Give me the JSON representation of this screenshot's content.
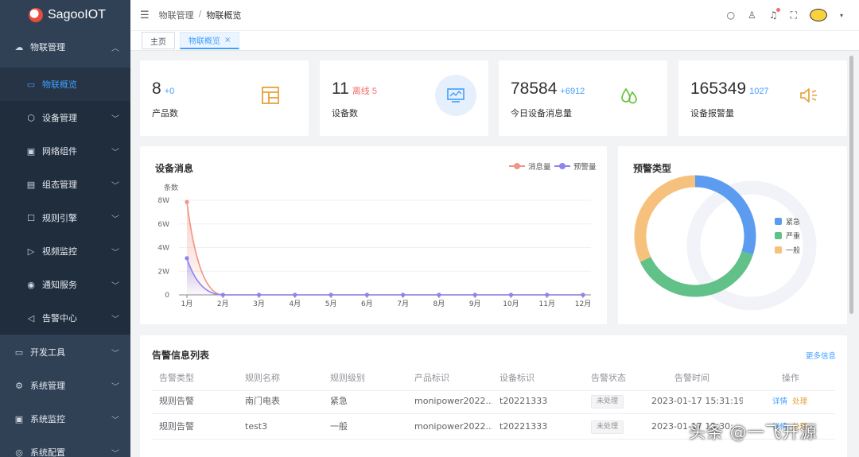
{
  "app": {
    "name": "SagooIOT"
  },
  "sidebar": {
    "items": [
      {
        "label": "物联管理",
        "icon": "cloud-icon",
        "glyph": "☁",
        "arrow": "︿"
      },
      {
        "label": "物联概览",
        "icon": "monitor-icon",
        "glyph": "▭"
      },
      {
        "label": "设备管理",
        "icon": "cube-icon",
        "glyph": "⬡",
        "arrow": "﹀"
      },
      {
        "label": "网络组件",
        "icon": "network-icon",
        "glyph": "▣",
        "arrow": "﹀"
      },
      {
        "label": "组态管理",
        "icon": "layout-icon",
        "glyph": "▤",
        "arrow": "﹀"
      },
      {
        "label": "规则引擎",
        "icon": "rule-icon",
        "glyph": "☐",
        "arrow": "﹀"
      },
      {
        "label": "视频监控",
        "icon": "video-icon",
        "glyph": "▷",
        "arrow": "﹀"
      },
      {
        "label": "通知服务",
        "icon": "broadcast-icon",
        "glyph": "◉",
        "arrow": "﹀"
      },
      {
        "label": "告警中心",
        "icon": "speaker-icon",
        "glyph": "◁",
        "arrow": "﹀"
      },
      {
        "label": "开发工具",
        "icon": "devtools-icon",
        "glyph": "▭",
        "arrow": "﹀"
      },
      {
        "label": "系统管理",
        "icon": "gear-icon",
        "glyph": "⚙",
        "arrow": "﹀"
      },
      {
        "label": "系统监控",
        "icon": "monitor-screen-icon",
        "glyph": "▣",
        "arrow": "﹀"
      },
      {
        "label": "系统配置",
        "icon": "config-icon",
        "glyph": "◎",
        "arrow": "﹀"
      }
    ]
  },
  "header": {
    "breadcrumb": [
      "物联管理",
      "物联概览"
    ],
    "separator": "/",
    "icons": [
      {
        "name": "search-icon",
        "glyph": "○"
      },
      {
        "name": "shirt-icon",
        "glyph": "♙"
      },
      {
        "name": "bell-icon",
        "glyph": "♫"
      },
      {
        "name": "fullscreen-icon",
        "glyph": "⛶"
      }
    ]
  },
  "tags": [
    {
      "label": "主页",
      "active": false
    },
    {
      "label": "物联概览",
      "active": true,
      "close": "×"
    }
  ],
  "stats": [
    {
      "value": "8",
      "sub": "+0",
      "sub_color": "#409eff",
      "label": "产品数",
      "icon": "product-layout-icon"
    },
    {
      "value": "11",
      "sub": "离线 5",
      "sub_color": "#f56c6c",
      "label": "设备数",
      "icon": "device-screen-icon"
    },
    {
      "value": "78584",
      "sub": "+6912",
      "sub_color": "#409eff",
      "label": "今日设备消息量",
      "icon": "message-drops-icon"
    },
    {
      "value": "165349",
      "sub": "1027",
      "sub_color": "#409eff",
      "label": "设备报警量",
      "icon": "alarm-speaker-icon"
    }
  ],
  "device_msg": {
    "title": "设备消息",
    "unit": "条数",
    "legend": [
      {
        "name": "消息量",
        "color": "#f19585"
      },
      {
        "name": "预警量",
        "color": "#8c84f0"
      }
    ]
  },
  "alert_type": {
    "title": "预警类型",
    "legend": [
      {
        "name": "紧急",
        "color": "#5b9bf0"
      },
      {
        "name": "严重",
        "color": "#61c189"
      },
      {
        "name": "一般",
        "color": "#f6c17c"
      }
    ]
  },
  "chart_data": [
    {
      "type": "line",
      "title": "设备消息",
      "ylabel": "条数",
      "categories": [
        "1月",
        "2月",
        "3月",
        "4月",
        "5月",
        "6月",
        "7月",
        "8月",
        "9月",
        "10月",
        "11月",
        "12月"
      ],
      "yticks": [
        "0",
        "2W",
        "4W",
        "6W",
        "8W"
      ],
      "ylim": [
        0,
        80000
      ],
      "series": [
        {
          "name": "消息量",
          "color": "#f19585",
          "values": [
            78584,
            0,
            0,
            0,
            0,
            0,
            0,
            0,
            0,
            0,
            0,
            0
          ]
        },
        {
          "name": "预警量",
          "color": "#8c84f0",
          "values": [
            31000,
            0,
            0,
            0,
            0,
            0,
            0,
            0,
            0,
            0,
            0,
            0
          ]
        }
      ]
    },
    {
      "type": "pie",
      "title": "预警类型",
      "categories": [
        "紧急",
        "严重",
        "一般"
      ],
      "values": [
        30,
        38,
        32
      ],
      "colors": [
        "#5b9bf0",
        "#61c189",
        "#f6c17c"
      ]
    }
  ],
  "alerts": {
    "title": "告警信息列表",
    "more": "更多信息",
    "columns": [
      "告警类型",
      "规则名称",
      "规则级别",
      "产品标识",
      "设备标识",
      "告警状态",
      "告警时间",
      "操作"
    ],
    "rows": [
      {
        "type": "规则告警",
        "rule": "南门电表",
        "level": "紧急",
        "product": "monipower2022...",
        "device": "t20221333",
        "status": "未处理",
        "time": "2023-01-17 15:31:19",
        "action1": "详情",
        "action2": "处理"
      },
      {
        "type": "规则告警",
        "rule": "test3",
        "level": "一般",
        "product": "monipower2022...",
        "device": "t20221333",
        "status": "未处理",
        "time": "2023-01-17 15:30:..",
        "action1": "详情",
        "action2": "处理"
      }
    ]
  },
  "watermark": "头条 @一飞开源"
}
